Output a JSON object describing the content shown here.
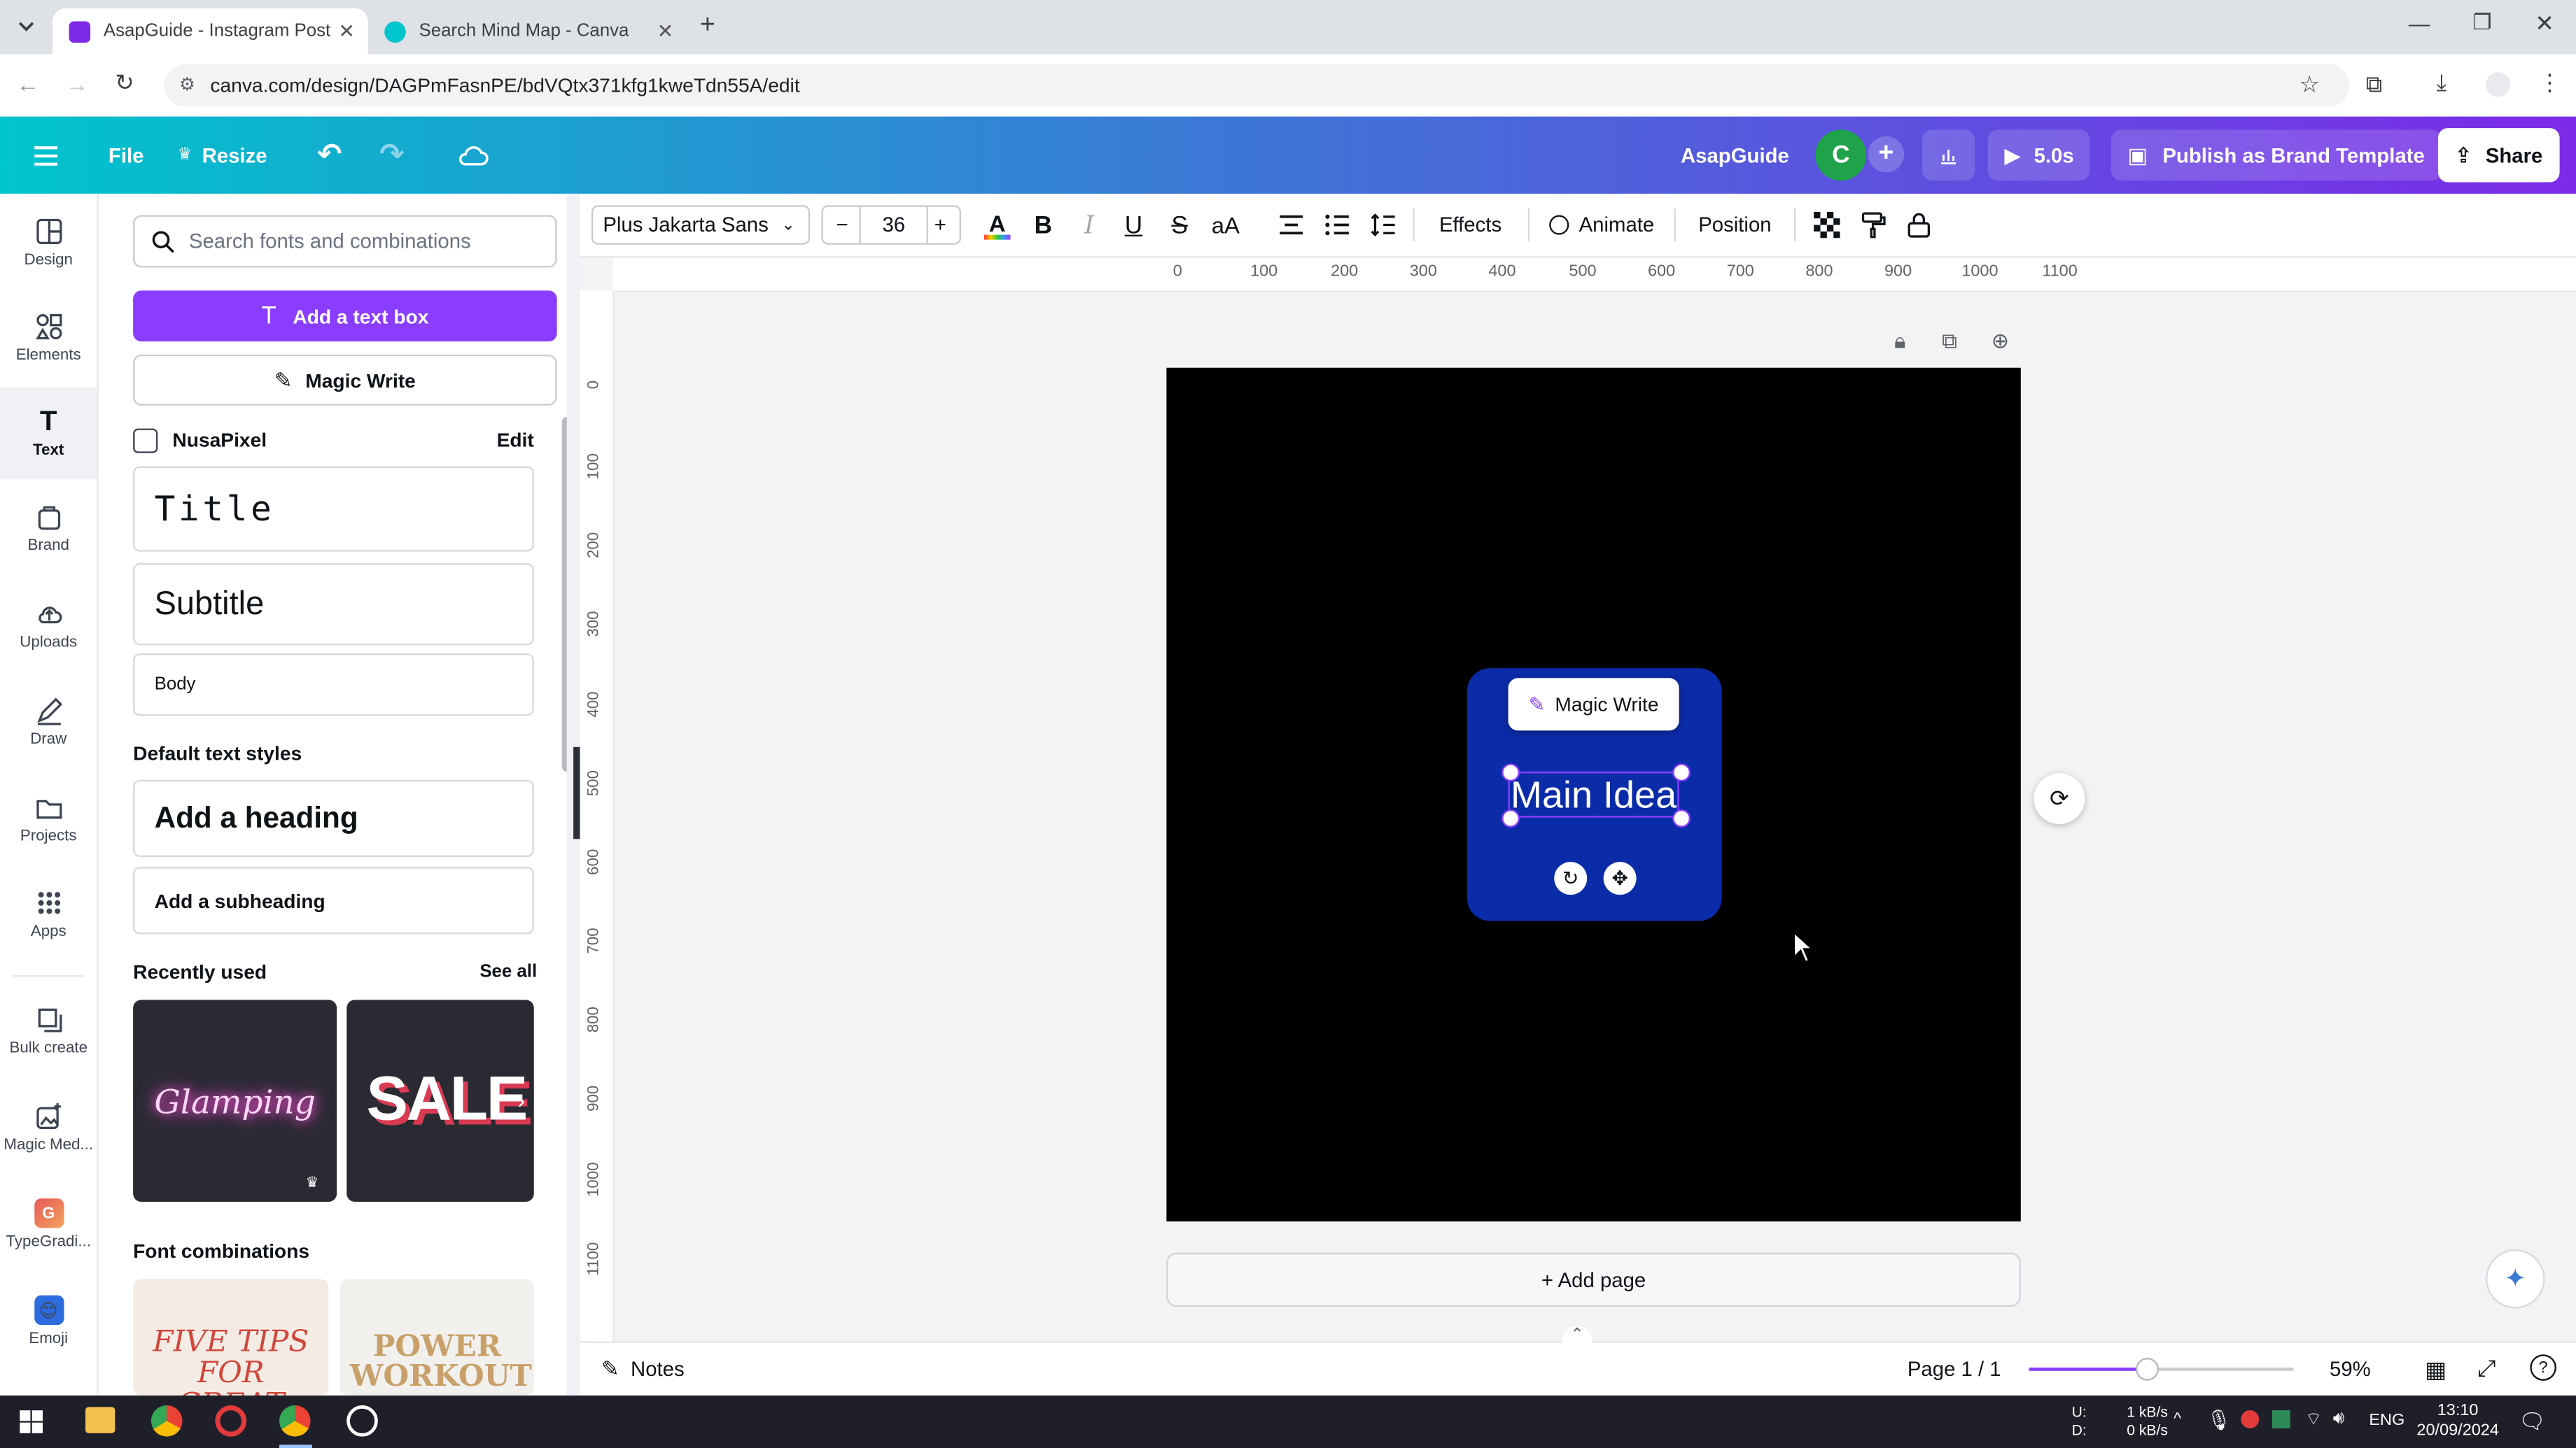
{
  "browser": {
    "tabs": [
      {
        "title": "AsapGuide - Instagram Post",
        "active": true
      },
      {
        "title": "Search Mind Map - Canva",
        "active": false
      }
    ],
    "url": "canva.com/design/DAGPmFasnPE/bdVQtx371kfg1kweTdn55A/edit"
  },
  "header": {
    "file_label": "File",
    "resize_label": "Resize",
    "brand_name": "AsapGuide",
    "avatar_letter": "C",
    "play_label": "5.0s",
    "publish_label": "Publish as Brand Template",
    "share_label": "Share"
  },
  "rail": {
    "items": [
      {
        "label": "Design",
        "icon": "design-icon"
      },
      {
        "label": "Elements",
        "icon": "elements-icon"
      },
      {
        "label": "Text",
        "icon": "text-icon",
        "active": true
      },
      {
        "label": "Brand",
        "icon": "brand-icon"
      },
      {
        "label": "Uploads",
        "icon": "uploads-icon"
      },
      {
        "label": "Draw",
        "icon": "draw-icon"
      },
      {
        "label": "Projects",
        "icon": "projects-icon"
      },
      {
        "label": "Apps",
        "icon": "apps-icon"
      },
      {
        "label": "Bulk create",
        "icon": "bulk-create-icon"
      },
      {
        "label": "Magic Med...",
        "icon": "magic-media-icon"
      },
      {
        "label": "TypeGradi...",
        "icon": "typegradient-icon"
      },
      {
        "label": "Emoji",
        "icon": "emoji-icon"
      }
    ]
  },
  "panel": {
    "search_placeholder": "Search fonts and combinations",
    "add_textbox_label": "Add a text box",
    "magic_write_label": "Magic Write",
    "brand_kit": {
      "name": "NusaPixel",
      "edit_label": "Edit"
    },
    "brand_styles": {
      "title": "Title",
      "subtitle": "Subtitle",
      "body": "Body"
    },
    "default_styles_heading": "Default text styles",
    "heading_label": "Add a heading",
    "subheading_label": "Add a subheading",
    "recently_used_heading": "Recently used",
    "see_all_label": "See all",
    "recent": [
      "Glamping",
      "SALE"
    ],
    "font_combinations_heading": "Font combinations",
    "combos": [
      "FIVE TIPS FOR GREAT",
      "POWER WORKOUT"
    ]
  },
  "toolbar": {
    "font_family": "Plus Jakarta Sans",
    "font_size": "36",
    "effects_label": "Effects",
    "animate_label": "Animate",
    "position_label": "Position"
  },
  "rulers": {
    "horizontal": [
      "0",
      "100",
      "200",
      "300",
      "400",
      "500",
      "600",
      "700",
      "800",
      "900",
      "1000",
      "1100"
    ],
    "vertical": [
      "0",
      "100",
      "200",
      "300",
      "400",
      "500",
      "600",
      "700",
      "800",
      "900",
      "1000",
      "1100"
    ]
  },
  "canvas": {
    "background_color": "#000000",
    "node_color": "#0b2ca8",
    "magic_write_bubble": "Magic Write",
    "main_text": "Main Idea",
    "add_page_label": "+ Add page"
  },
  "footer": {
    "notes_label": "Notes",
    "page_indicator": "Page 1 / 1",
    "zoom": "59%",
    "zoom_fraction": 0.45
  },
  "taskbar": {
    "net_up_label": "U:",
    "net_down_label": "D:",
    "net_up": "1 kB/s",
    "net_down": "0 kB/s",
    "language": "ENG",
    "time": "13:10",
    "date": "20/09/2024"
  }
}
